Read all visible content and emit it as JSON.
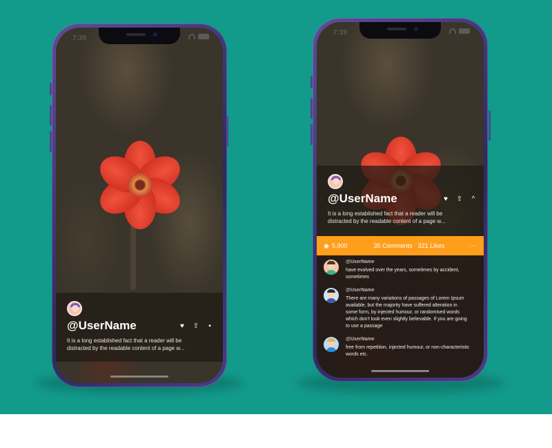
{
  "left_phone": {
    "status_time": "7:38",
    "username": "@UserName",
    "description": "It is a long established fact that a reader will be distracted by the readable content of a page w...",
    "actions": {
      "like_icon": "heart-icon",
      "share_icon": "share-icon",
      "comment_icon": "comment-icon"
    }
  },
  "right_phone": {
    "status_time": "7:39",
    "username": "@UserName",
    "description": "It is a long established fact that a reader will be distracted by the readable content of a page w...",
    "stats": {
      "views": "5,900",
      "comments": "35 Comments",
      "likes": "321 Likes",
      "more": "···"
    },
    "comments": [
      {
        "name": "@UserName",
        "text": "have evolved over the years, sometimes by accident, sometimes",
        "avatar_bg": "#f3c6a8",
        "shirt": "#39b38a"
      },
      {
        "name": "@UserName",
        "text": "There are many variations of passages of Lorem Ipsum available, but the majority have suffered alteration in some form, by injected humour, or randomised words which don't look even slightly believable. If you are going to use a passage",
        "avatar_bg": "#cfe3f6",
        "shirt": "#3f5aa8"
      },
      {
        "name": "@UserName",
        "text": " free from repetition, injected humour, or non-characteristic words etc.",
        "avatar_bg": "#b9dcf4",
        "shirt": "#2c8bd3"
      }
    ]
  },
  "colors": {
    "background": "#129a8a",
    "accent_bar": "#ff9e1a",
    "phone_frame": "#2d2963"
  }
}
